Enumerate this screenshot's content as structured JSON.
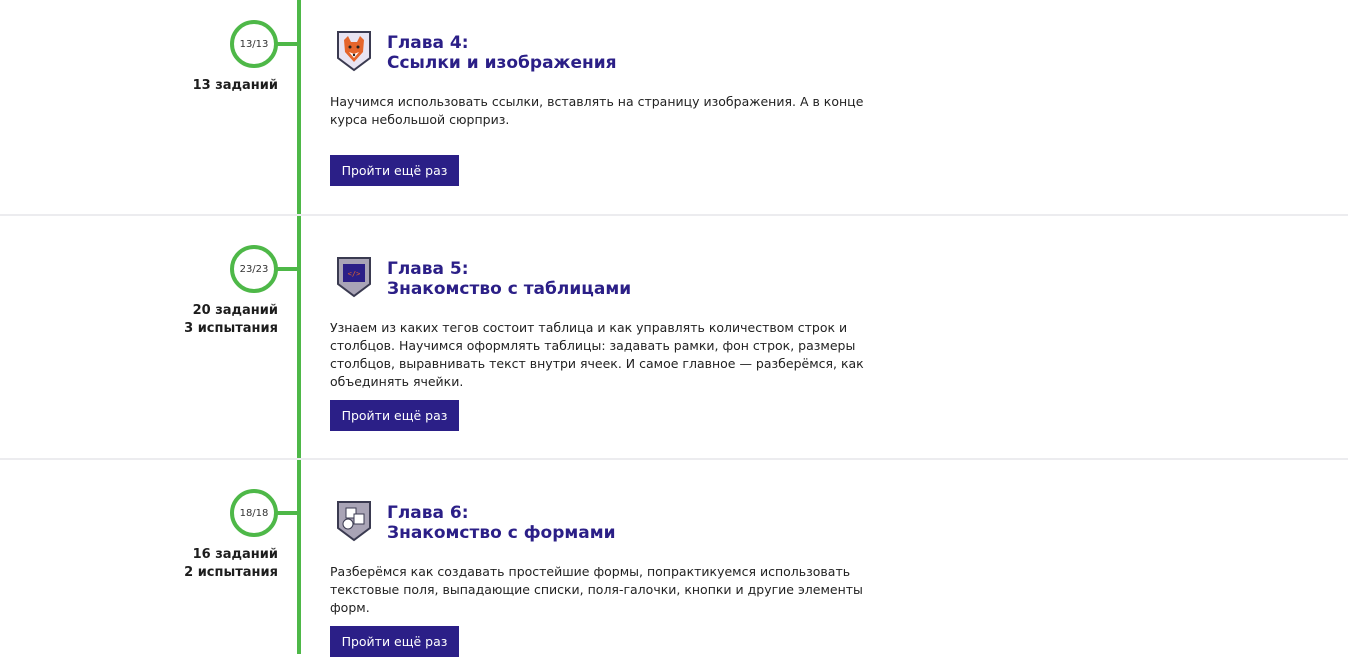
{
  "chapters": [
    {
      "progress": "13/13",
      "stats": [
        "13 заданий"
      ],
      "title_line1": "Глава 4:",
      "title_line2": "Ссылки и изображения",
      "description": "Научимся использовать ссылки, вставлять на страницу изображения. А в конце курса небольшой сюрприз.",
      "button_label": "Пройти ещё раз",
      "badge_icon": "fox-icon"
    },
    {
      "progress": "23/23",
      "stats": [
        "20 заданий",
        "3 испытания"
      ],
      "title_line1": "Глава 5:",
      "title_line2": "Знакомство с таблицами",
      "description": "Узнаем из каких тегов состоит таблица и как управлять количеством строк и столбцов. Научимся оформлять таблицы: задавать рамки, фон строк, размеры столбцов, выравнивать текст внутри ячеек. И самое главное — разберёмся, как объединять ячейки.",
      "button_label": "Пройти ещё раз",
      "badge_icon": "code-screen-icon",
      "badge_text": "</>"
    },
    {
      "progress": "18/18",
      "stats": [
        "16 заданий",
        "2 испытания"
      ],
      "title_line1": "Глава 6:",
      "title_line2": "Знакомство с формами",
      "description": "Разберёмся как создавать простейшие формы, попрактикуемся использовать текстовые поля, выпадающие списки, поля-галочки, кнопки и другие элементы форм.",
      "button_label": "Пройти ещё раз",
      "badge_icon": "form-cubes-icon"
    }
  ],
  "colors": {
    "accent": "#4eb848",
    "brand": "#2b1f87",
    "divider": "#ececef"
  }
}
